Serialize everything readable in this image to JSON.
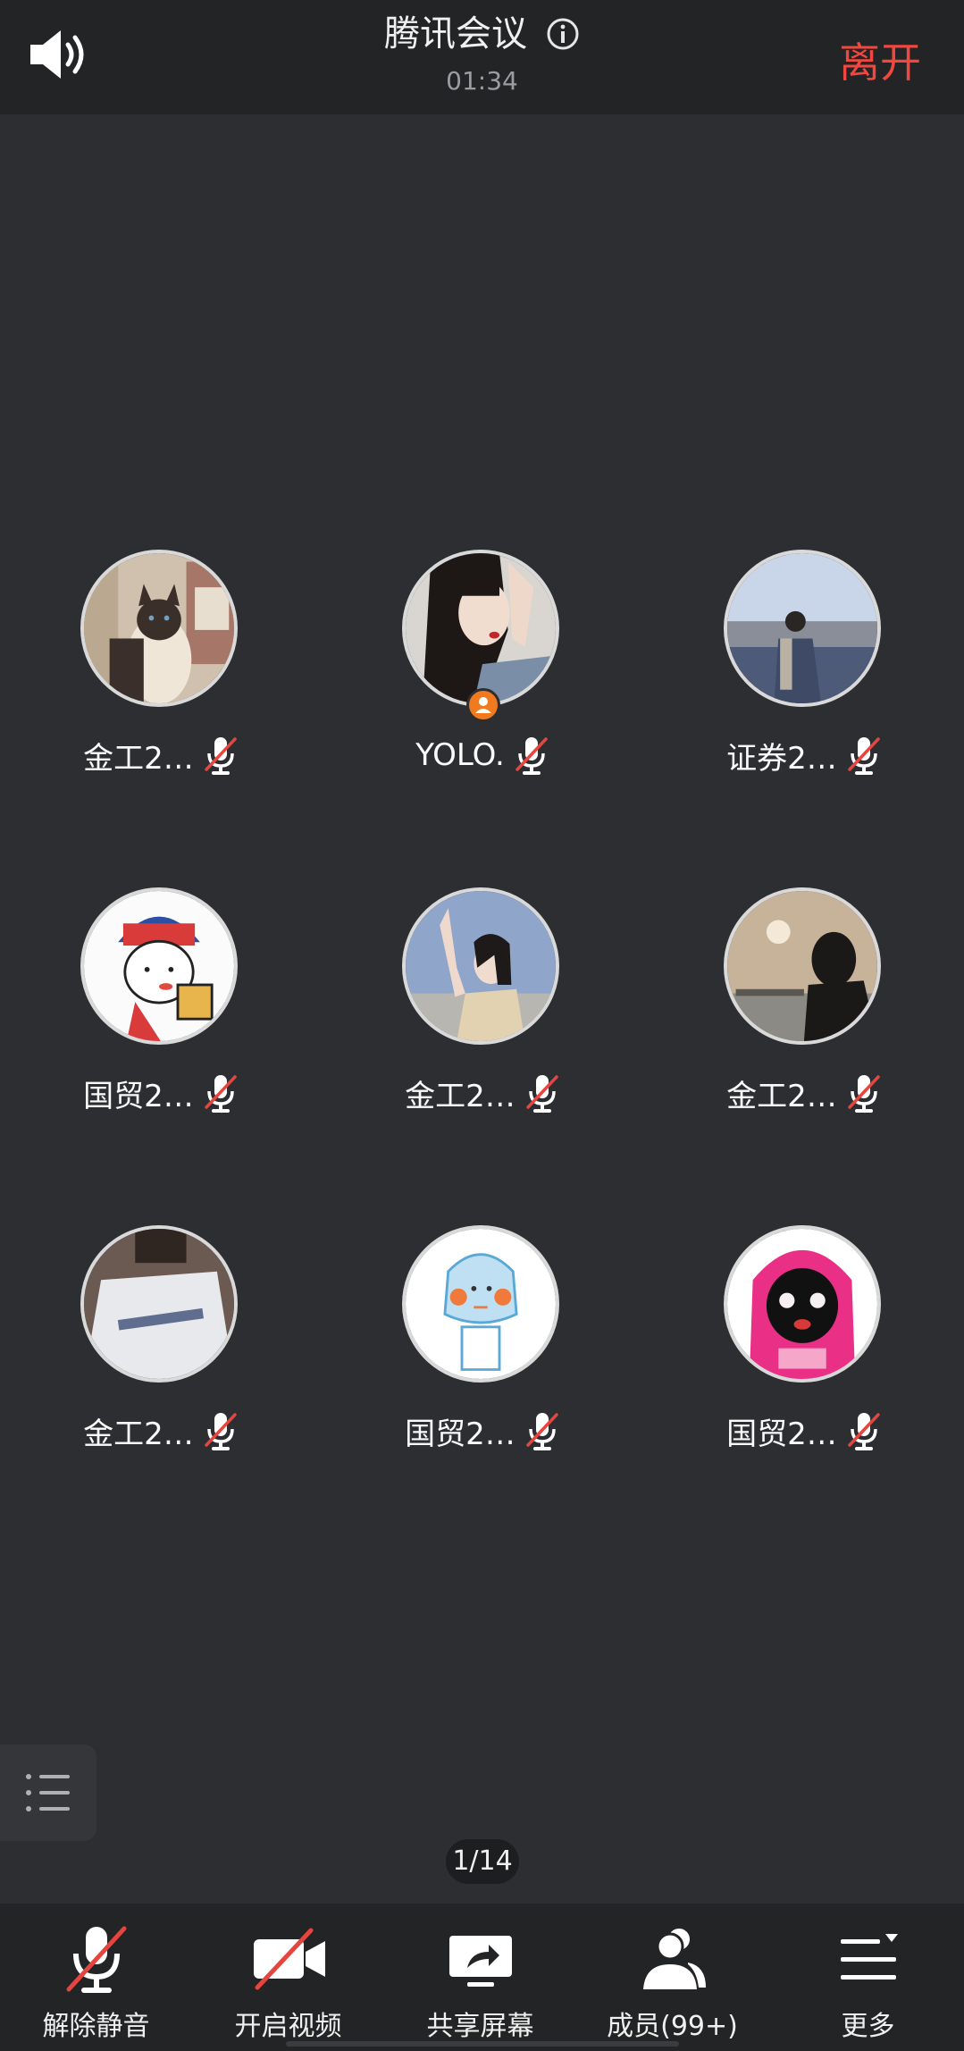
{
  "header": {
    "title": "腾讯会议",
    "timer": "01:34",
    "leave_label": "离开",
    "speaker_icon": "speaker-icon",
    "info_icon": "info-icon"
  },
  "participants": [
    {
      "name": "金工2…",
      "avatar": "cat-photo",
      "host": false
    },
    {
      "name": "YOLO.",
      "avatar": "woman-illustration",
      "host": true
    },
    {
      "name": "证券2…",
      "avatar": "seaside-person-photo",
      "host": false
    },
    {
      "name": "国贸2…",
      "avatar": "cartoon-boy",
      "host": false
    },
    {
      "name": "金工2…",
      "avatar": "girl-sky-photo",
      "host": false
    },
    {
      "name": "金工2…",
      "avatar": "sunset-silhouette",
      "host": false
    },
    {
      "name": "金工2…",
      "avatar": "white-shirt-photo",
      "host": false
    },
    {
      "name": "国贸2…",
      "avatar": "blue-doodle",
      "host": false
    },
    {
      "name": "国贸2…",
      "avatar": "pink-cartoon",
      "host": false
    }
  ],
  "pager": "1/14",
  "toolbar": [
    {
      "label": "解除静音",
      "icon": "mic-muted-icon"
    },
    {
      "label": "开启视频",
      "icon": "video-off-icon"
    },
    {
      "label": "共享屏幕",
      "icon": "share-screen-icon"
    },
    {
      "label": "成员(99+)",
      "icon": "members-icon"
    },
    {
      "label": "更多",
      "icon": "more-icon"
    }
  ],
  "colors": {
    "background": "#2c2e31",
    "bar": "#232426",
    "leave": "#f2473f",
    "host_badge": "#f07a1d",
    "mute_slash": "#e5453e"
  }
}
